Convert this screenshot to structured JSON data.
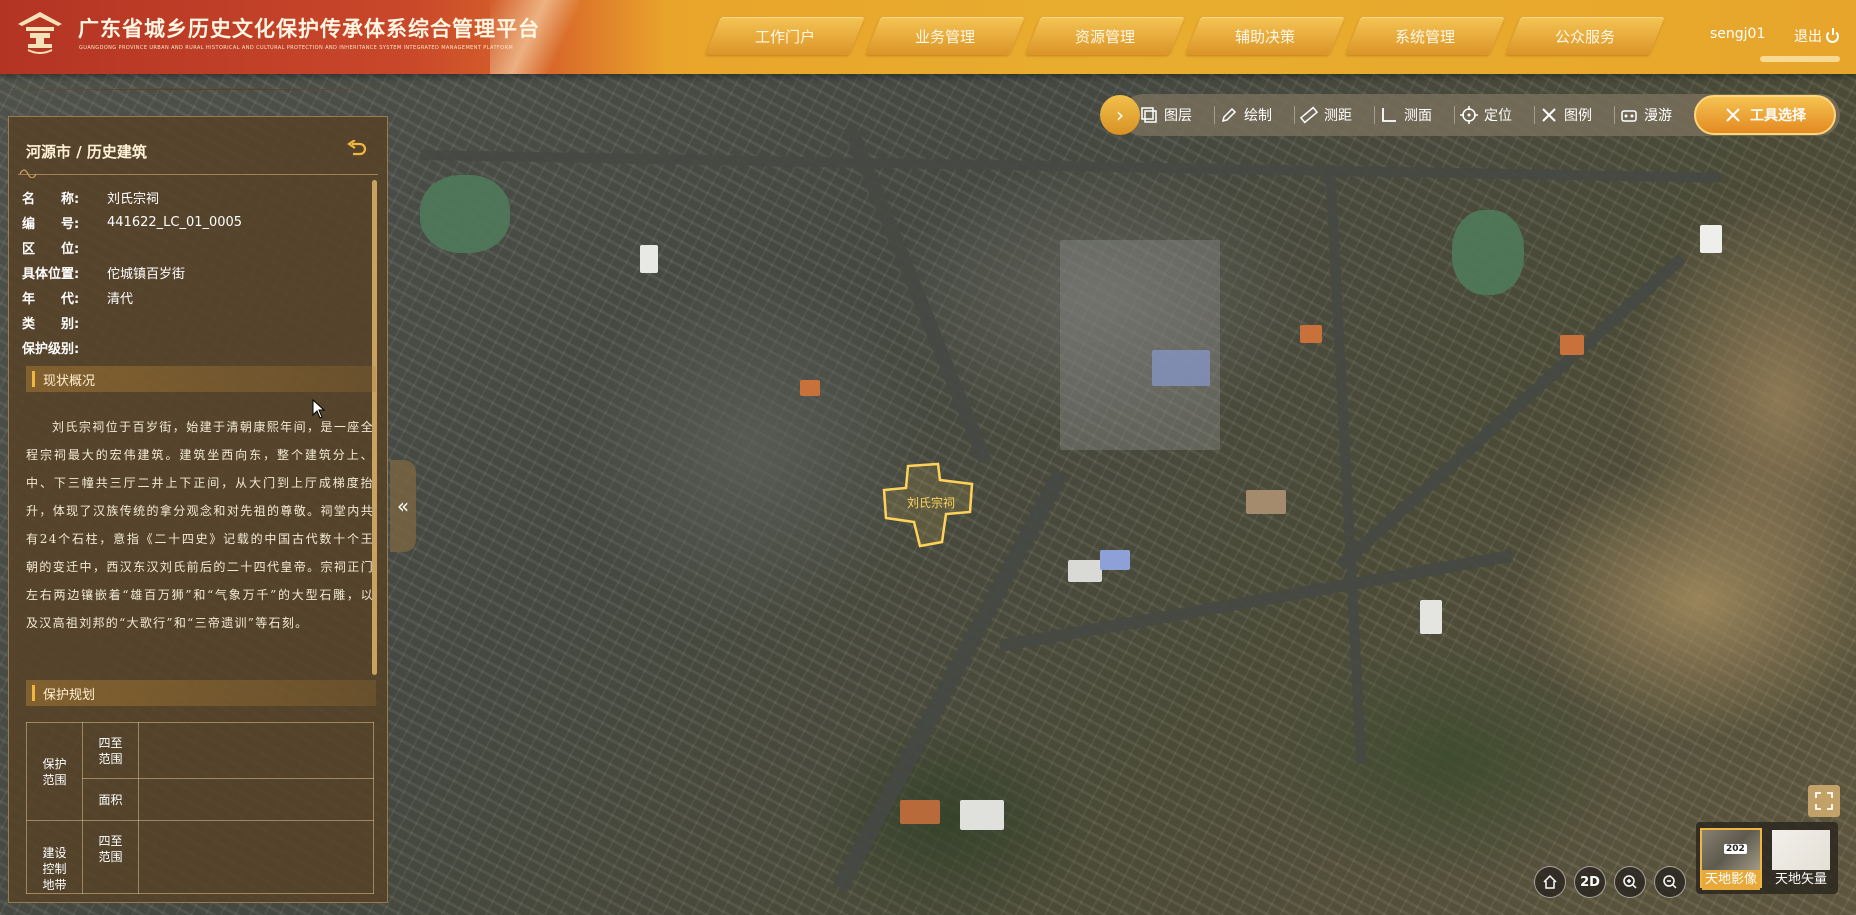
{
  "header": {
    "title": "广东省城乡历史文化保护传承体系综合管理平台",
    "subtitle": "GUANGDONG PROVINCE URBAN AND RURAL HISTORICAL AND CULTURAL PROTECTION AND INHERITANCE SYSTEM INTEGRATED MANAGEMENT PLATFORM",
    "nav": [
      "工作门户",
      "业务管理",
      "资源管理",
      "辅助决策",
      "系统管理",
      "公众服务"
    ],
    "user": "sengj01",
    "logout": "退出"
  },
  "toolbar": {
    "items": [
      "图层",
      "绘制",
      "测距",
      "测面",
      "定位",
      "图例",
      "漫游"
    ],
    "tool_select": "工具选择"
  },
  "panel": {
    "heading": "河源市 / 历史建筑",
    "attributes": [
      {
        "key": "名　　称:",
        "value": "刘氏宗祠"
      },
      {
        "key": "编　　号:",
        "value": "441622_LC_01_0005"
      },
      {
        "key": "区　　位:",
        "value": ""
      },
      {
        "key": "具体位置:",
        "value": "佗城镇百岁街"
      },
      {
        "key": "年　　代:",
        "value": "清代"
      },
      {
        "key": "类　　别:",
        "value": ""
      },
      {
        "key": "保护级别:",
        "value": ""
      }
    ],
    "section_status": "现状概况",
    "description": "刘氏宗祠位于百岁街，始建于清朝康熙年间，是一座全程宗祠最大的宏伟建筑。建筑坐西向东，整个建筑分上、中、下三幢共三厅二井上下正间，从大门到上厅成梯度抬升，体现了汉族传统的拿分观念和对先祖的尊敬。祠堂内共有24个石柱，意指《二十四史》记载的中国古代数十个王朝的变迁中，西汉东汉刘氏前后的二十四代皇帝。宗祠正门左右两边镶嵌着“雄百万狮”和“气象万千”的大型石雕，以及汉高祖刘邦的“大歌行”和“三帝遗训”等石刻。",
    "section_plan": "保护规划",
    "plan_table": {
      "group1": "保护范围",
      "group1_rows": [
        "四至范围",
        "面积"
      ],
      "group2": "建设控制地带",
      "group2_rows": [
        "四至范围"
      ]
    }
  },
  "map": {
    "parcel_label": "刘氏宗祠",
    "accent_color": "#f1b640"
  },
  "controls": {
    "mode_2d": "2D",
    "basemaps": [
      {
        "label": "天地影像",
        "active": true,
        "badge": "202"
      },
      {
        "label": "天地矢量",
        "active": false
      }
    ]
  }
}
